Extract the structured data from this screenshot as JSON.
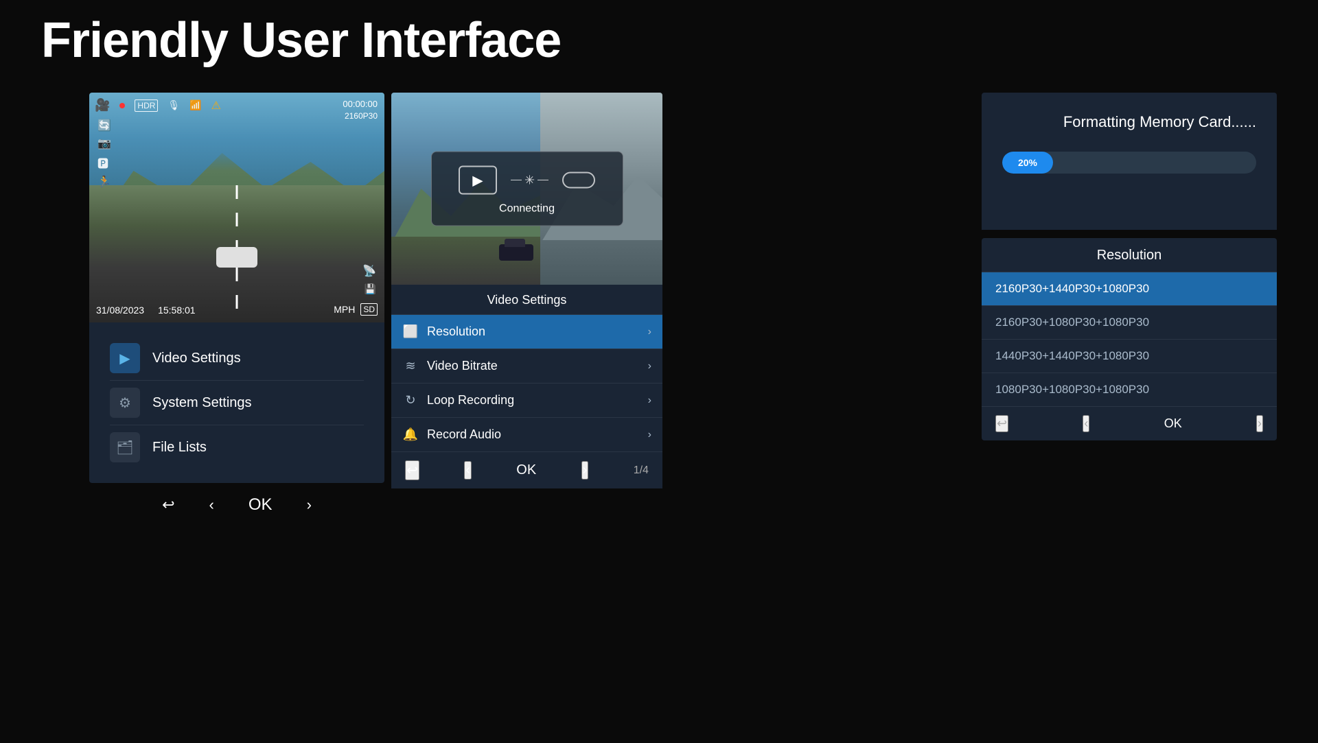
{
  "page": {
    "title": "Friendly User Interface",
    "background": "#0a0a0a"
  },
  "left_panel": {
    "dashcam": {
      "timestamp": "00:00:00",
      "resolution": "2160P30",
      "date": "31/08/2023",
      "time": "15:58:01",
      "speed": "MPH"
    },
    "menu": {
      "items": [
        {
          "label": "Video Settings",
          "icon": "▶",
          "type": "video"
        },
        {
          "label": "System Settings",
          "icon": "⚙",
          "type": "gear"
        },
        {
          "label": "File Lists",
          "icon": "🗂",
          "type": "folder"
        }
      ]
    },
    "nav": {
      "back": "↩",
      "left": "‹",
      "ok": "OK",
      "right": "›"
    }
  },
  "center_panel": {
    "connecting_text": "Connecting",
    "video_settings": {
      "title": "Video Settings",
      "items": [
        {
          "label": "Resolution",
          "active": true
        },
        {
          "label": "Video Bitrate",
          "active": false
        },
        {
          "label": "Loop Recording",
          "active": false
        },
        {
          "label": "Record Audio",
          "active": false
        }
      ],
      "page_indicator": "1/4"
    },
    "nav": {
      "back": "↩",
      "left": "‹",
      "ok": "OK",
      "right": "›"
    }
  },
  "right_panel": {
    "format": {
      "title": "Formatting Memory Card......",
      "progress": 20,
      "progress_text": "20%"
    },
    "resolution": {
      "title": "Resolution",
      "items": [
        {
          "label": "2160P30+1440P30+1080P30",
          "selected": true
        },
        {
          "label": "2160P30+1080P30+1080P30",
          "selected": false
        },
        {
          "label": "1440P30+1440P30+1080P30",
          "selected": false
        },
        {
          "label": "1080P30+1080P30+1080P30",
          "selected": false
        }
      ]
    },
    "nav": {
      "back": "↩",
      "left": "‹",
      "ok": "OK",
      "right": "›"
    }
  }
}
